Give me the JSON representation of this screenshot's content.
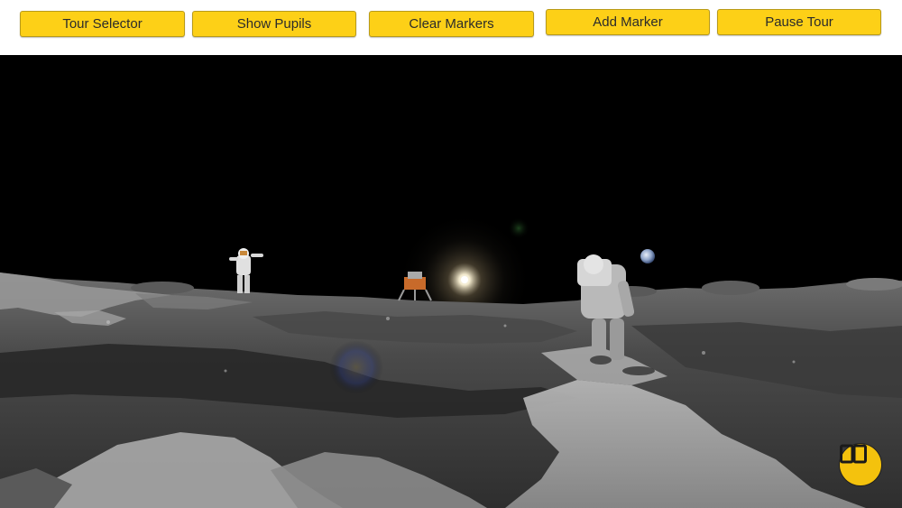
{
  "toolbar": {
    "buttons": [
      {
        "label": "Tour Selector"
      },
      {
        "label": "Show Pupils"
      },
      {
        "label": "Clear Markers"
      },
      {
        "label": "Add Marker"
      },
      {
        "label": "Pause Tour"
      }
    ]
  },
  "scene": {
    "description_icons": [
      "sun-icon",
      "earth-icon",
      "astronaut-icon",
      "lunar-lander-icon"
    ]
  },
  "colors": {
    "button_bg": "#fdd017",
    "book_button_bg": "#f4c20d",
    "sky": "#000000"
  }
}
